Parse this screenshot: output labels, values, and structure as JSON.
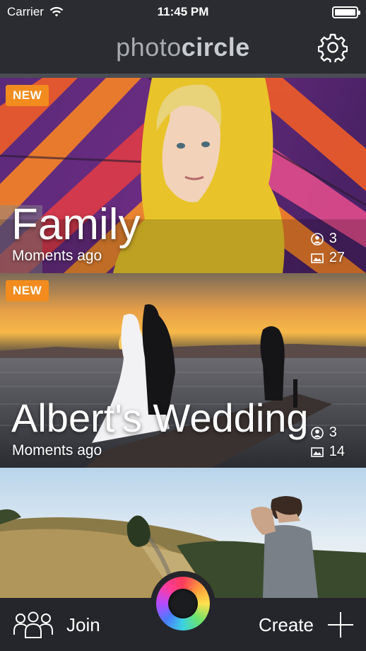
{
  "status_bar": {
    "carrier": "Carrier",
    "time": "11:45 PM",
    "battery_level": 1.0
  },
  "header": {
    "logo_light": "photo",
    "logo_bold": "circle",
    "settings_icon": "gear-icon"
  },
  "cards": [
    {
      "badge": "NEW",
      "title": "Family",
      "time": "Moments ago",
      "members": "3",
      "photos": "27"
    },
    {
      "badge": "NEW",
      "title": "Albert's Wedding",
      "time": "Moments ago",
      "members": "3",
      "photos": "14"
    },
    {
      "badge": "",
      "title": "",
      "time": ""
    }
  ],
  "tab_bar": {
    "join_label": "Join",
    "create_label": "Create",
    "join_icon": "group-icon",
    "create_icon": "plus-icon",
    "camera_icon": "camera-lens-icon"
  }
}
